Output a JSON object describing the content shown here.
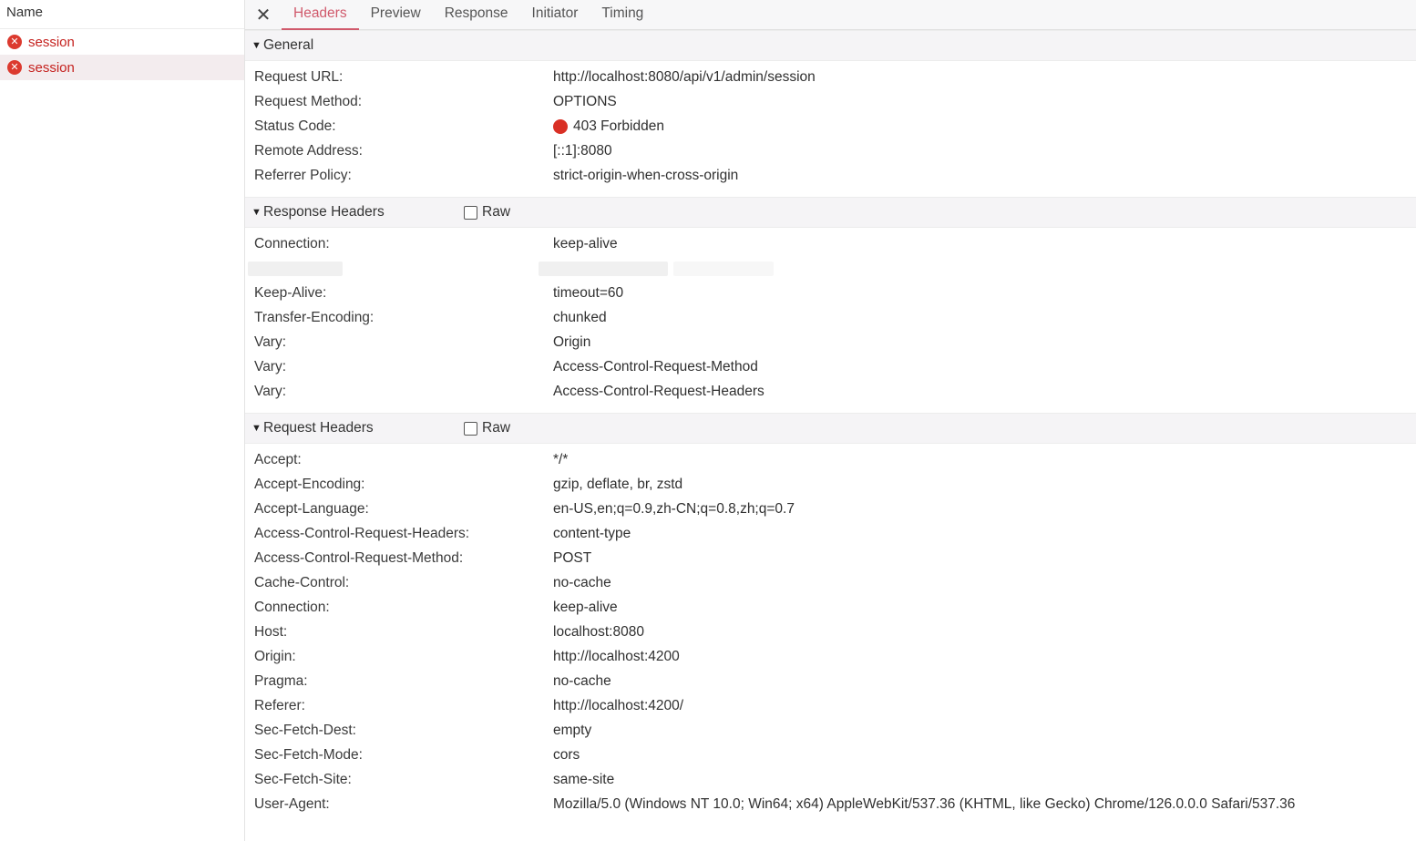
{
  "request_list": {
    "header": "Name",
    "items": [
      {
        "name": "session",
        "selected": false
      },
      {
        "name": "session",
        "selected": true
      }
    ]
  },
  "tabs": [
    {
      "label": "Headers",
      "active": true
    },
    {
      "label": "Preview",
      "active": false
    },
    {
      "label": "Response",
      "active": false
    },
    {
      "label": "Initiator",
      "active": false
    },
    {
      "label": "Timing",
      "active": false
    }
  ],
  "general": {
    "title": "General",
    "rows": [
      {
        "key": "Request URL:",
        "value": "http://localhost:8080/api/v1/admin/session"
      },
      {
        "key": "Request Method:",
        "value": "OPTIONS"
      },
      {
        "key": "Status Code:",
        "value": "403 Forbidden"
      },
      {
        "key": "Remote Address:",
        "value": "[::1]:8080"
      },
      {
        "key": "Referrer Policy:",
        "value": "strict-origin-when-cross-origin"
      }
    ]
  },
  "response_headers": {
    "title": "Response Headers",
    "raw_label": "Raw",
    "rows": [
      {
        "key": "Connection:",
        "value": "keep-alive"
      },
      {
        "key": "Keep-Alive:",
        "value": "timeout=60"
      },
      {
        "key": "Transfer-Encoding:",
        "value": "chunked"
      },
      {
        "key": "Vary:",
        "value": "Origin"
      },
      {
        "key": "Vary:",
        "value": "Access-Control-Request-Method"
      },
      {
        "key": "Vary:",
        "value": "Access-Control-Request-Headers"
      }
    ]
  },
  "request_headers": {
    "title": "Request Headers",
    "raw_label": "Raw",
    "rows": [
      {
        "key": "Accept:",
        "value": "*/*"
      },
      {
        "key": "Accept-Encoding:",
        "value": "gzip, deflate, br, zstd"
      },
      {
        "key": "Accept-Language:",
        "value": "en-US,en;q=0.9,zh-CN;q=0.8,zh;q=0.7"
      },
      {
        "key": "Access-Control-Request-Headers:",
        "value": "content-type"
      },
      {
        "key": "Access-Control-Request-Method:",
        "value": "POST"
      },
      {
        "key": "Cache-Control:",
        "value": "no-cache"
      },
      {
        "key": "Connection:",
        "value": "keep-alive"
      },
      {
        "key": "Host:",
        "value": "localhost:8080"
      },
      {
        "key": "Origin:",
        "value": "http://localhost:4200"
      },
      {
        "key": "Pragma:",
        "value": "no-cache"
      },
      {
        "key": "Referer:",
        "value": "http://localhost:4200/"
      },
      {
        "key": "Sec-Fetch-Dest:",
        "value": "empty"
      },
      {
        "key": "Sec-Fetch-Mode:",
        "value": "cors"
      },
      {
        "key": "Sec-Fetch-Site:",
        "value": "same-site"
      },
      {
        "key": "User-Agent:",
        "value": "Mozilla/5.0 (Windows NT 10.0; Win64; x64) AppleWebKit/537.36 (KHTML, like Gecko) Chrome/126.0.0.0 Safari/537.36"
      }
    ]
  },
  "icons": {
    "close": "close-icon",
    "error": "error-circle-icon",
    "status": "status-dot-icon",
    "expand": "triangle-down-icon"
  },
  "colors": {
    "accent": "#d05a6c",
    "error": "#dc3a2f",
    "status_dot": "#d93025"
  }
}
